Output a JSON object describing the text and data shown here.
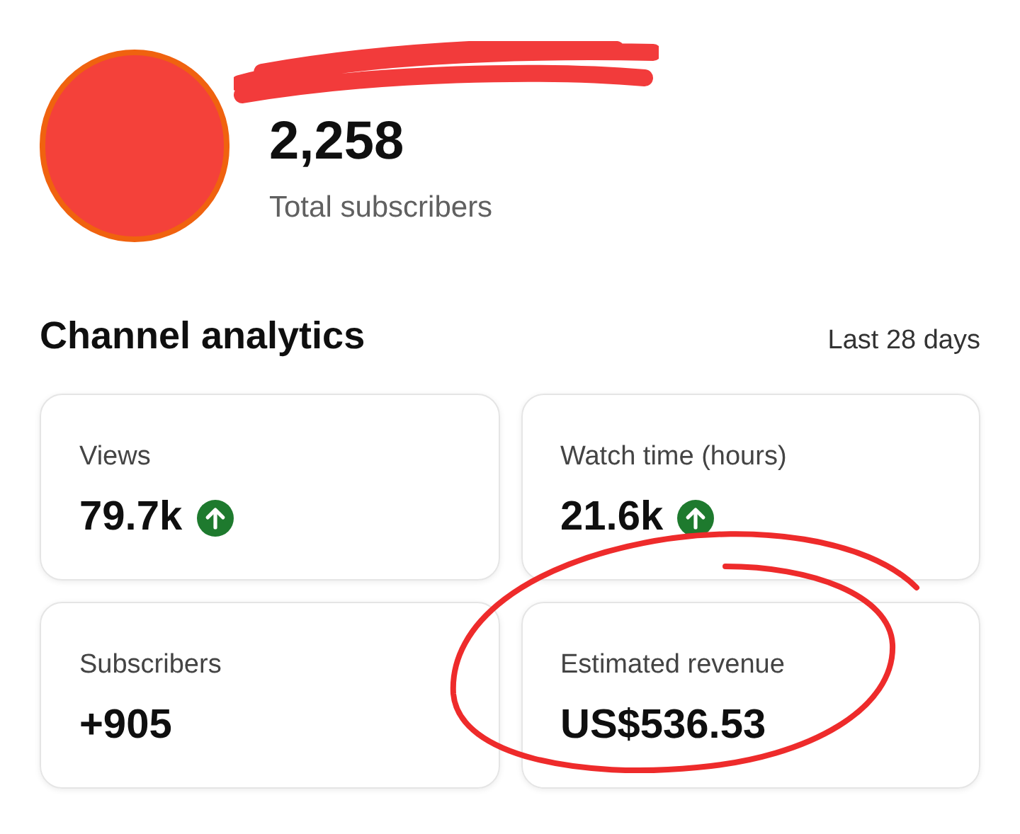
{
  "channel": {
    "subscriber_count": "2,258",
    "subscriber_label": "Total subscribers"
  },
  "analytics": {
    "title": "Channel analytics",
    "period": "Last 28 days",
    "cards": [
      {
        "label": "Views",
        "value": "79.7k",
        "trend_up": true
      },
      {
        "label": "Watch time (hours)",
        "value": "21.6k",
        "trend_up": true
      },
      {
        "label": "Subscribers",
        "value": "+905",
        "trend_up": false
      },
      {
        "label": "Estimated revenue",
        "value": "US$536.53",
        "trend_up": false
      }
    ]
  }
}
